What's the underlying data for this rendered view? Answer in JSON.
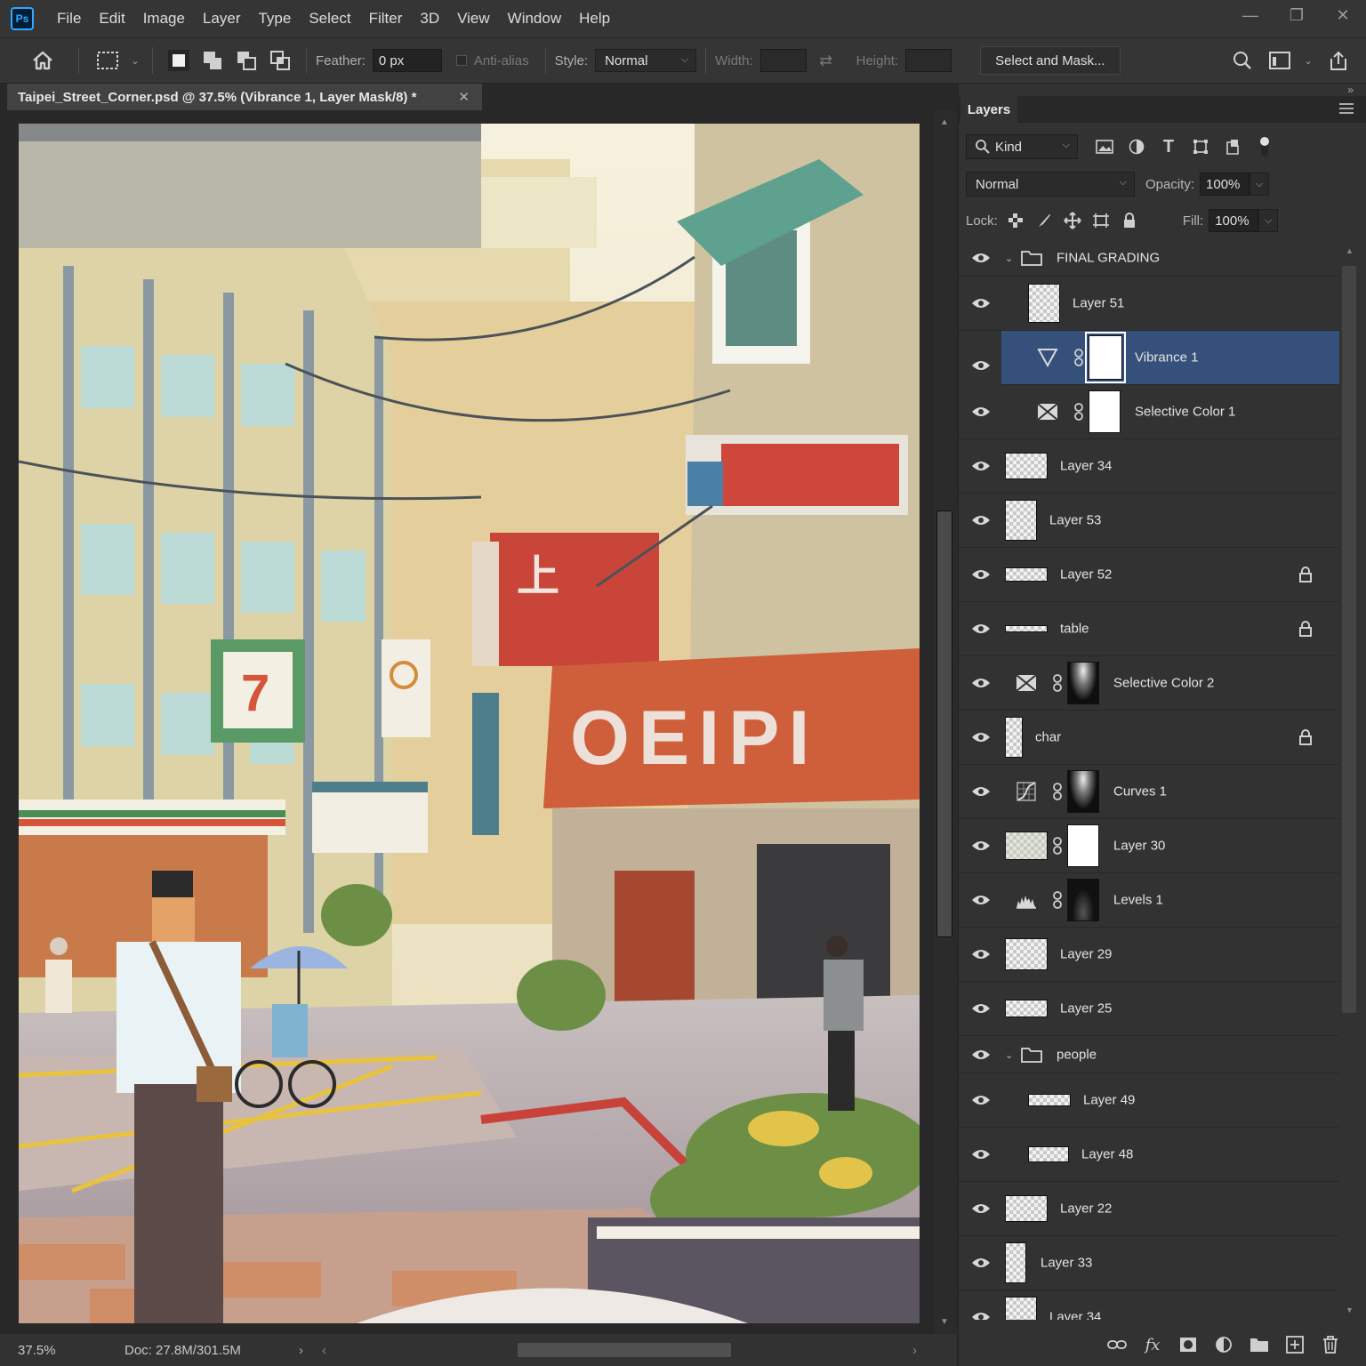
{
  "menu": {
    "items": [
      "File",
      "Edit",
      "Image",
      "Layer",
      "Type",
      "Select",
      "Filter",
      "3D",
      "View",
      "Window",
      "Help"
    ],
    "logo": "Ps"
  },
  "options": {
    "feather_label": "Feather:",
    "feather_value": "0 px",
    "antialias_label": "Anti-alias",
    "style_label": "Style:",
    "style_value": "Normal",
    "width_label": "Width:",
    "height_label": "Height:",
    "select_mask_label": "Select and Mask..."
  },
  "document": {
    "tab_title": "Taipei_Street_Corner.psd @ 37.5% (Vibrance 1, Layer Mask/8) *",
    "zoom": "37.5%",
    "doc_size": "Doc: 27.8M/301.5M"
  },
  "layers_panel": {
    "tab_label": "Layers",
    "filter_kind": "Kind",
    "blend_mode": "Normal",
    "opacity_label": "Opacity:",
    "opacity_value": "100%",
    "lock_label": "Lock:",
    "fill_label": "Fill:",
    "fill_value": "100%",
    "layers": [
      {
        "name": "FINAL GRADING",
        "type": "group"
      },
      {
        "name": "Layer 51",
        "type": "pixel"
      },
      {
        "name": "Vibrance 1",
        "type": "adjustment",
        "selected": true
      },
      {
        "name": "Selective Color 1",
        "type": "adjustment"
      },
      {
        "name": "Layer 34",
        "type": "pixel"
      },
      {
        "name": "Layer 53",
        "type": "pixel"
      },
      {
        "name": "Layer 52",
        "type": "pixel",
        "locked": true
      },
      {
        "name": "table",
        "type": "pixel",
        "locked": true
      },
      {
        "name": "Selective Color 2",
        "type": "adjustment"
      },
      {
        "name": "char",
        "type": "pixel",
        "locked": true
      },
      {
        "name": "Curves 1",
        "type": "adjustment"
      },
      {
        "name": "Layer 30",
        "type": "pixel"
      },
      {
        "name": "Levels 1",
        "type": "adjustment"
      },
      {
        "name": "Layer 29",
        "type": "pixel"
      },
      {
        "name": "Layer 25",
        "type": "pixel"
      },
      {
        "name": "people",
        "type": "group"
      },
      {
        "name": "Layer 49",
        "type": "pixel"
      },
      {
        "name": "Layer 48",
        "type": "pixel"
      },
      {
        "name": "Layer 22",
        "type": "pixel"
      },
      {
        "name": "Layer 33",
        "type": "pixel"
      },
      {
        "name": "Layer 34",
        "type": "pixel"
      }
    ]
  },
  "colors": {
    "accent": "#31a8ff",
    "selection": "#35507a"
  }
}
